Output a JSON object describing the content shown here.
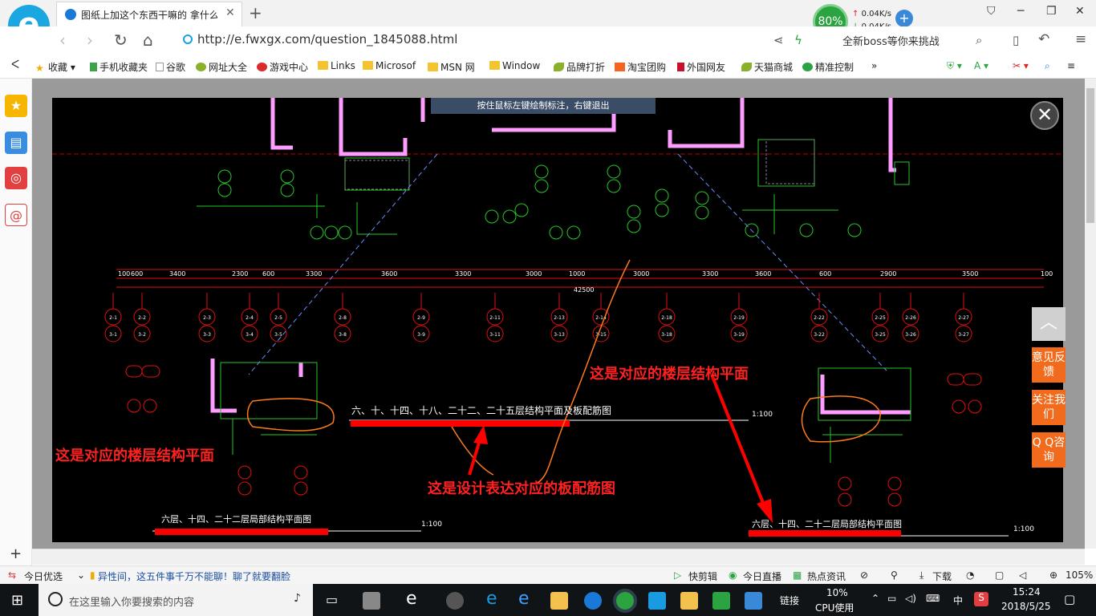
{
  "browser": {
    "tab_title": "图纸上加这个东西干嘛的 拿什么",
    "url": "http://e.fwxgx.com/question_1845088.html",
    "speed_percent": "80%",
    "upload_rate": "0.04K/s",
    "download_rate": "0.04K/s",
    "promo_text": "全新boss等你来挑战"
  },
  "bookmarks": [
    {
      "label": "收藏",
      "icon": "star-icon"
    },
    {
      "label": "手机收藏夹",
      "icon": "phone-icon"
    },
    {
      "label": "谷歌",
      "icon": "page-icon"
    },
    {
      "label": "网址大全",
      "icon": "site-icon"
    },
    {
      "label": "游戏中心",
      "icon": "game-icon"
    },
    {
      "label": "Links",
      "icon": "folder-icon"
    },
    {
      "label": "Microsof",
      "icon": "folder-icon"
    },
    {
      "label": "MSN 网",
      "icon": "folder-icon"
    },
    {
      "label": "Window",
      "icon": "folder-icon"
    },
    {
      "label": "品牌打折",
      "icon": "leaf-icon"
    },
    {
      "label": "淘宝团购",
      "icon": "taobao-icon"
    },
    {
      "label": "外国网友",
      "icon": "flag-icon"
    },
    {
      "label": "天猫商城",
      "icon": "leaf-icon"
    },
    {
      "label": "精准控制",
      "icon": "wechat-icon"
    }
  ],
  "viewer": {
    "hint": "按住鼠标左键绘制标注，右键退出",
    "side_buttons": [
      "意见反馈",
      "关注我们",
      "Q Q咨询"
    ]
  },
  "drawing": {
    "annotation_left": "这是对应的楼层结构平面",
    "annotation_right": "这是对应的楼层结构平面",
    "annotation_center": "这是设计表达对应的板配筋图",
    "title_center": "六、十、十四、十八、二十二、二十五层结构平面及板配筋图",
    "title_left": "六层、十四、二十二层局部结构平面图",
    "title_right": "六层、十四、二十二层局部结构平面图",
    "scale": "1:100",
    "total_dim": "42500",
    "dims": [
      "100",
      "600",
      "3400",
      "2300",
      "600",
      "3300",
      "3600",
      "3300",
      "3000",
      "1000",
      "3000",
      "3300",
      "3600",
      "600",
      "2900",
      "3500",
      "100"
    ],
    "axes_top": [
      "2-1",
      "2-2",
      "2-3",
      "2-4",
      "2-5",
      "2-8",
      "2-9",
      "2-11",
      "2-13",
      "2-14",
      "2-18",
      "2-19",
      "2-22",
      "2-25",
      "2-26",
      "2-27"
    ],
    "axes_bot": [
      "3-1",
      "3-2",
      "3-3",
      "3-4",
      "3-5",
      "3-8",
      "3-9",
      "3-11",
      "3-13",
      "3-15",
      "3-18",
      "3-19",
      "3-22",
      "3-25",
      "3-26",
      "3-27"
    ]
  },
  "statusbar": {
    "left_label": "今日优选",
    "headline": "异性间，这五件事千万不能聊！聊了就要翻脸",
    "items": [
      "快剪辑",
      "今日直播",
      "热点资讯",
      "下载"
    ],
    "zoom": "105%"
  },
  "taskbar": {
    "search_placeholder": "在这里输入你要搜索的内容",
    "link_label": "链接",
    "cpu_percent": "10%",
    "cpu_label": "CPU使用",
    "ime": "中",
    "time": "15:24",
    "date": "2018/5/25"
  }
}
